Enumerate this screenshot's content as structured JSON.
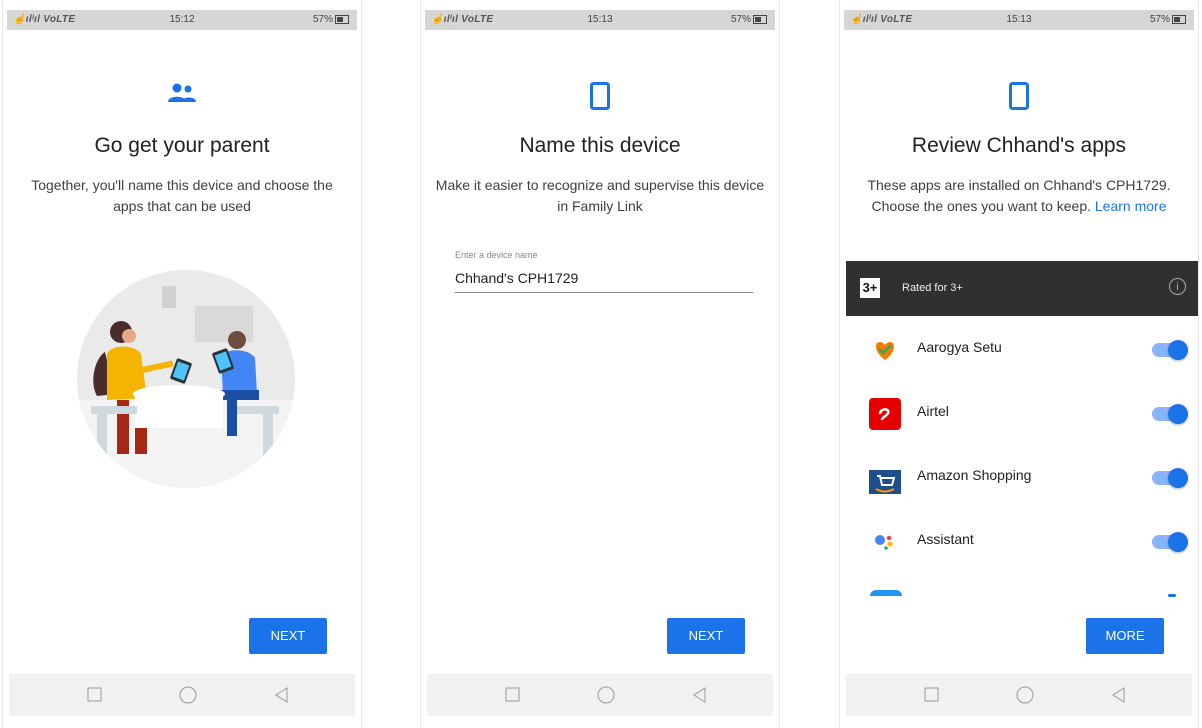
{
  "status": {
    "carrier": "☝ılˡıl VoLTE",
    "battery": "57%",
    "times": [
      "15:12",
      "15:13",
      "15:13"
    ]
  },
  "screen1": {
    "icon": "family-icon",
    "title": "Go get your parent",
    "description": "Together, you'll name this device and choose the apps that can be used",
    "next": "NEXT"
  },
  "screen2": {
    "icon": "phone-icon",
    "title": "Name this device",
    "description": "Make it easier to recognize and supervise this device in Family Link",
    "field_label": "Enter a device name",
    "field_value": "Chhand's CPH1729",
    "next": "NEXT"
  },
  "screen3": {
    "icon": "phone-icon",
    "title": "Review Chhand's apps",
    "description": "These apps are installed on Chhand's CPH1729. Choose the ones you want to keep.",
    "learn_more": "Learn more",
    "rating_badge": "3+",
    "rating_label": "Rated for 3+",
    "apps": [
      {
        "name": "Aarogya Setu",
        "enabled": true
      },
      {
        "name": "Airtel",
        "enabled": true
      },
      {
        "name": "Amazon Shopping",
        "enabled": true
      },
      {
        "name": "Assistant",
        "enabled": true
      }
    ],
    "more": "MORE"
  },
  "colors": {
    "accent": "#1a73e8",
    "rated_bar": "#303030"
  }
}
